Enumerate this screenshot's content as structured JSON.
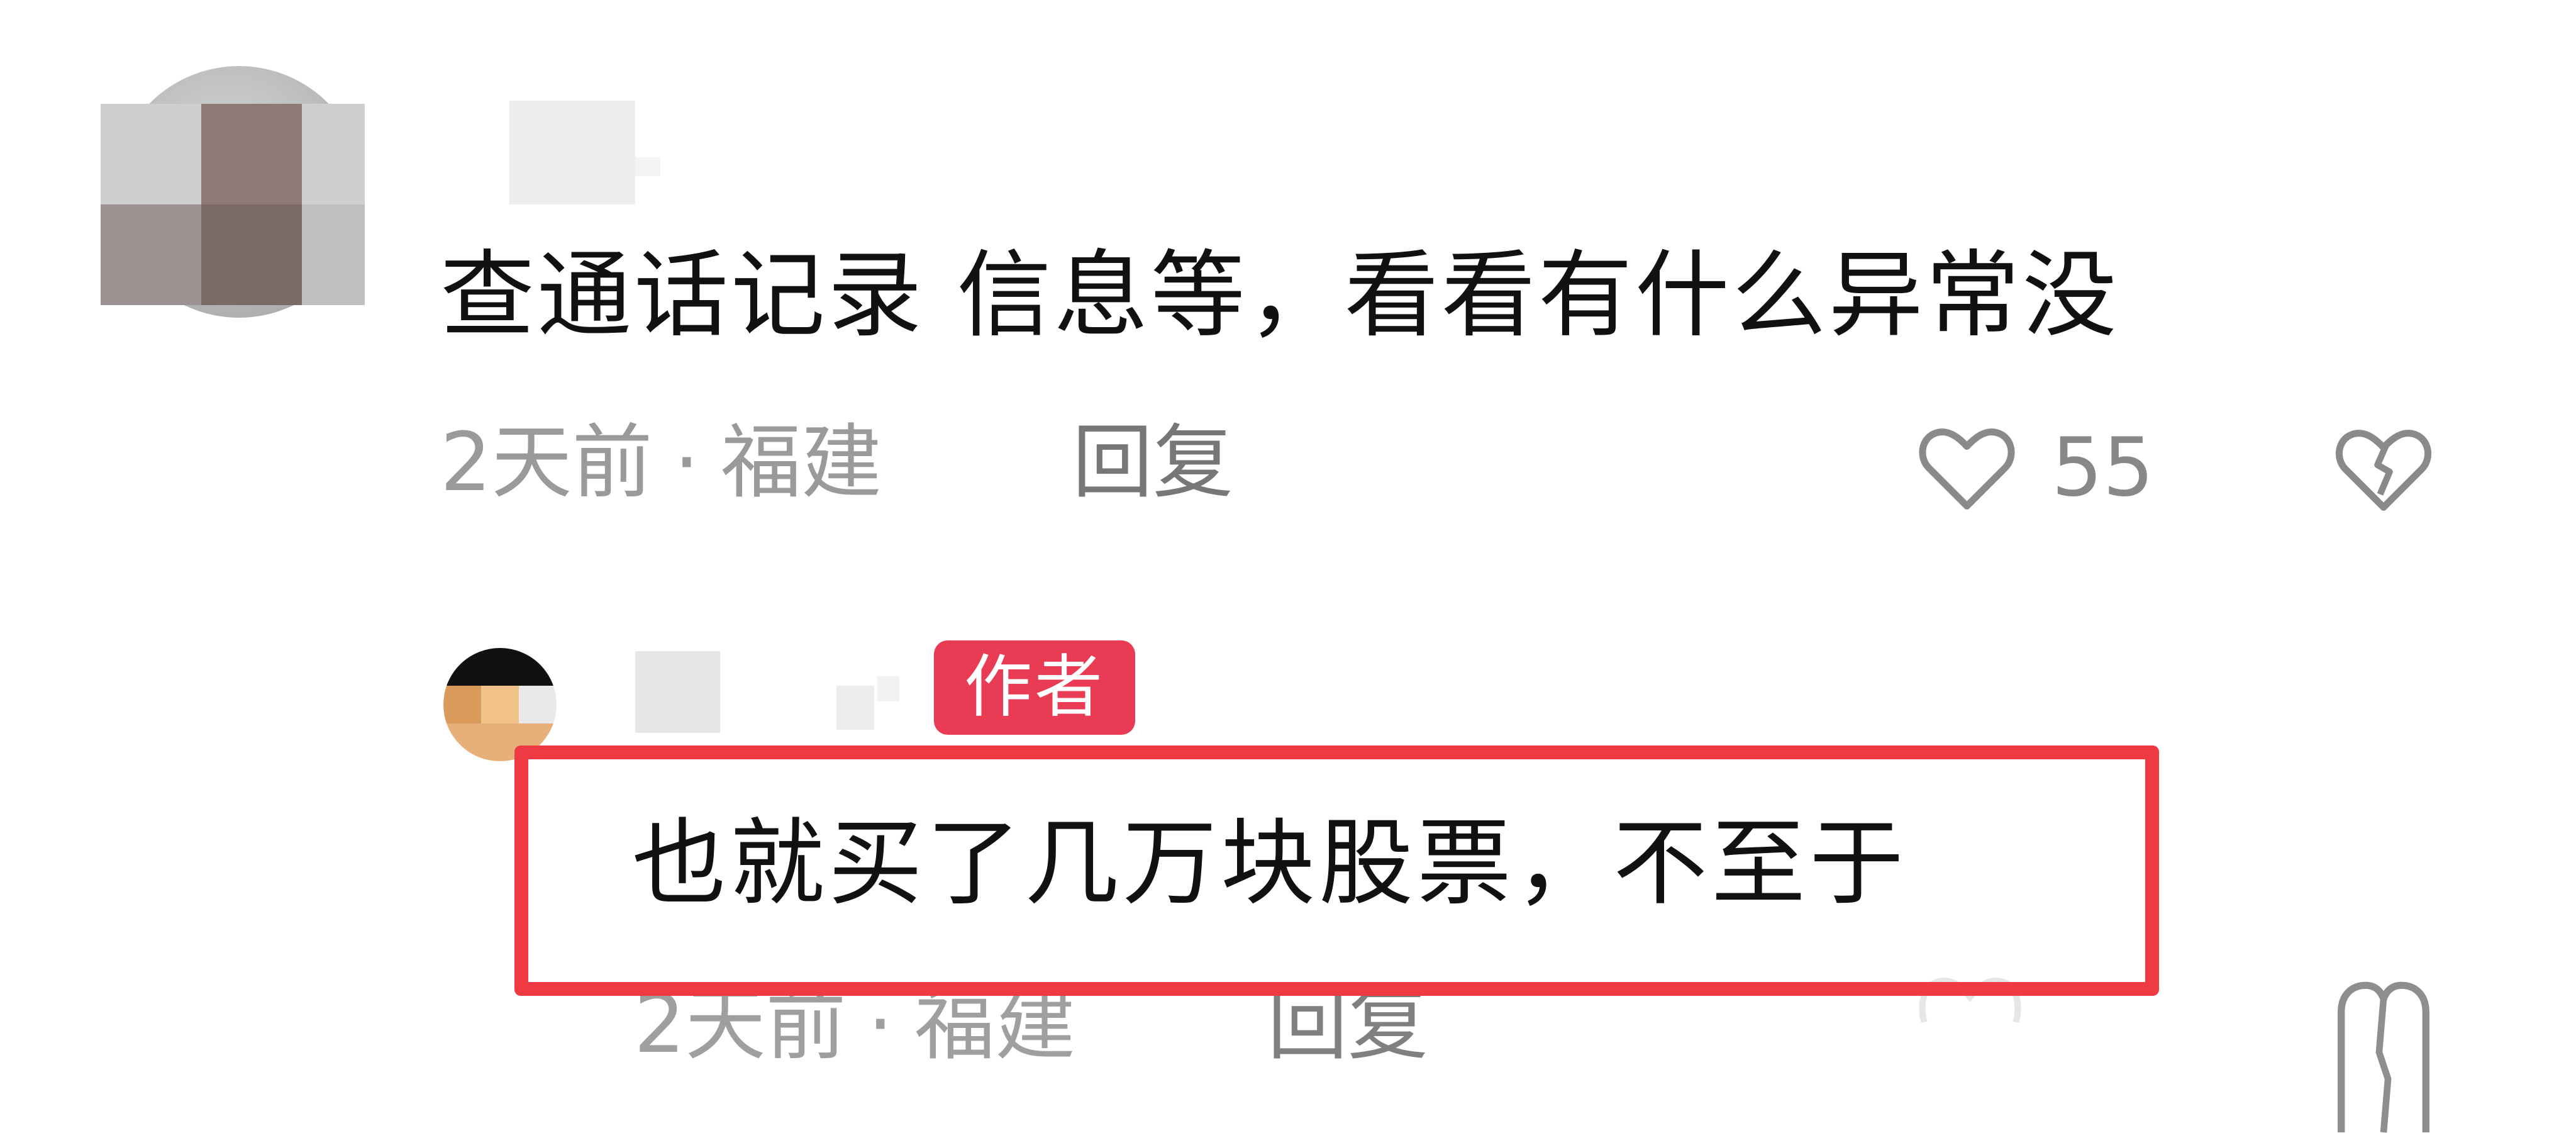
{
  "comments": [
    {
      "text": "查通话记录  信息等，看看有什么异常没",
      "time": "2天前",
      "location": "福建",
      "reply_label": "回复",
      "like_count": "55"
    }
  ],
  "reply": {
    "badge": "作者",
    "text": "也就买了几万块股票，不至于",
    "time": "2天前",
    "location": "福建",
    "reply_label": "回复"
  },
  "colors": {
    "badge_bg": "#ea3b55",
    "highlight_border": "#ee3b43",
    "meta_text": "#9a9a9a",
    "body_text": "#111111"
  },
  "icons": {
    "like": "heart-outline-icon",
    "dislike": "broken-heart-icon"
  }
}
